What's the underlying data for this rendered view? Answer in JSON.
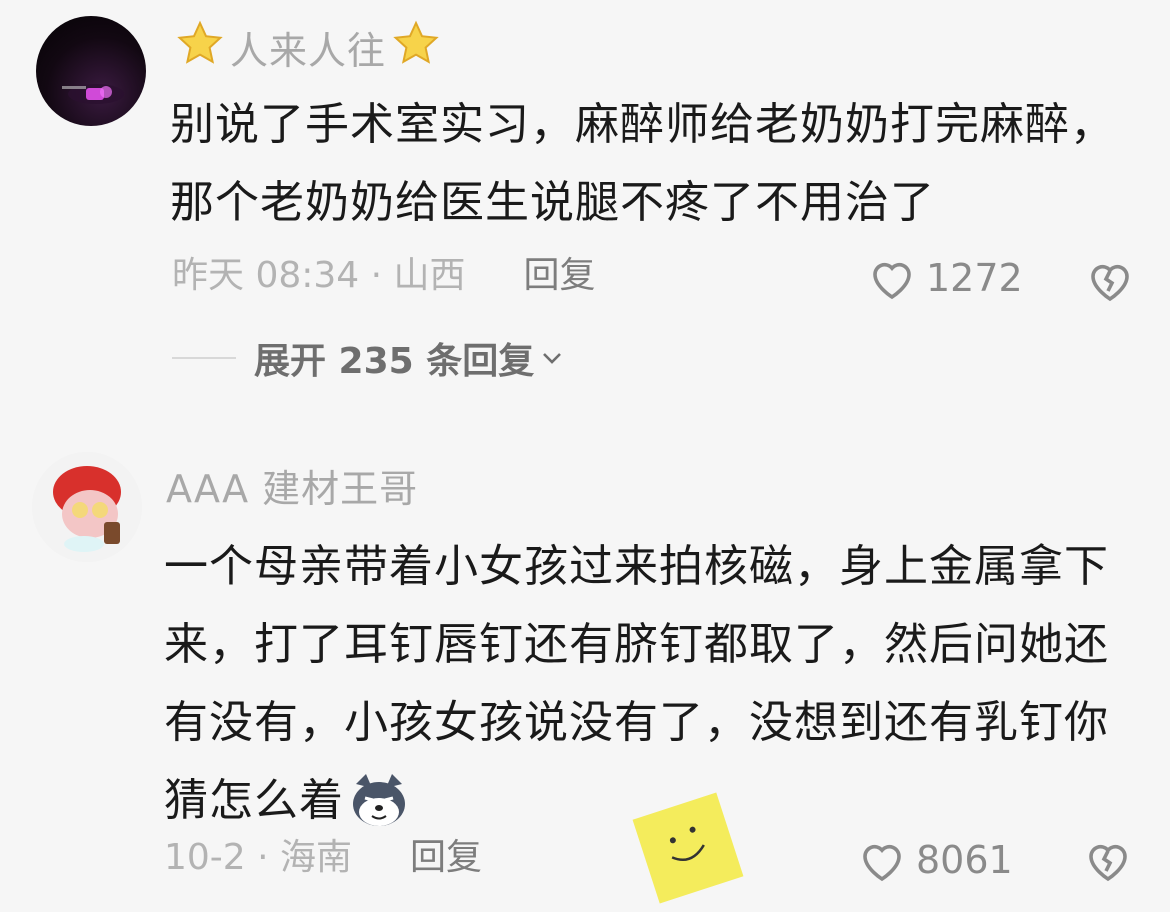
{
  "comments": [
    {
      "username": "人来人往",
      "username_decoration": "star-icon",
      "lines": [
        "别说了手术室实习，麻醉师给老奶奶打完麻醉，",
        "那个老奶奶给医生说腿不疼了不用治了"
      ],
      "meta": "昨天 08:34 · 山西",
      "reply_label": "回复",
      "likes": "1272",
      "expand_label": "展开 235 条回复"
    },
    {
      "username": "AAA 建材王哥",
      "lines": [
        "一个母亲带着小女孩过来拍核磁，身上金属拿下",
        "来，打了耳钉唇钉还有脐钉都取了，然后问她还",
        "有没有，小孩女孩说没有了，没想到还有乳钉你",
        "猜怎么着"
      ],
      "emoji": "husky-smirk-icon",
      "meta": "10-2 · 海南",
      "reply_label": "回复",
      "likes": "8061"
    }
  ],
  "colors": {
    "background": "#f6f6f6",
    "text": "#1a1a1a",
    "muted": "#b3b3b3",
    "sticker": "#f4ec5c"
  }
}
